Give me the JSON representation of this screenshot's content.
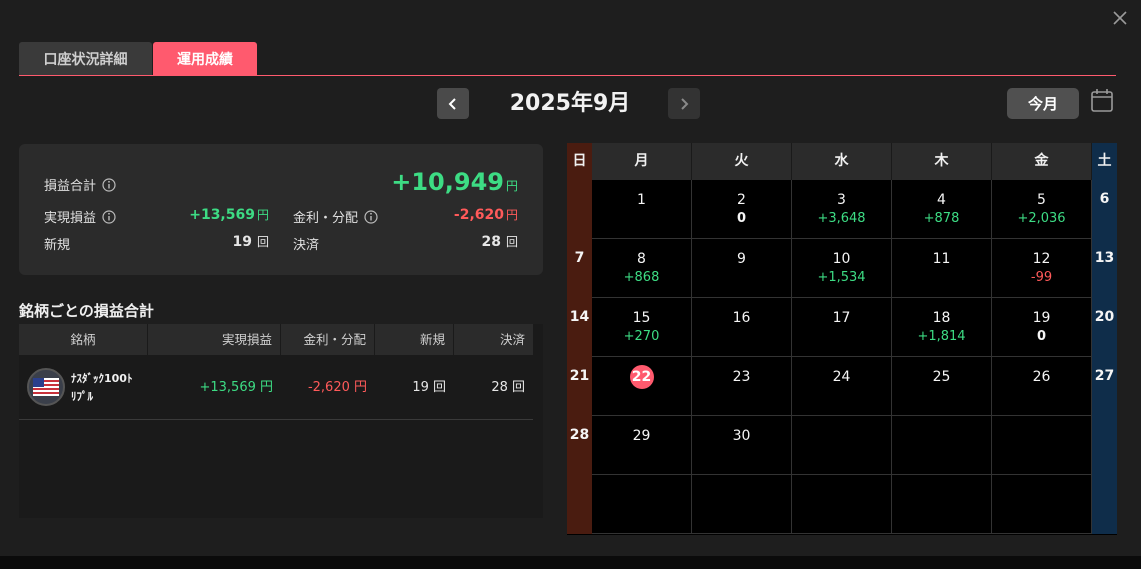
{
  "tabs": [
    {
      "label": "口座状況詳細",
      "active": false
    },
    {
      "label": "運用成績",
      "active": true
    }
  ],
  "nav": {
    "month_title": "2025年9月",
    "today_label": "今月"
  },
  "summary": {
    "total_label": "損益合計",
    "total_value": "+10,949",
    "realized_label": "実現損益",
    "realized_value": "+13,569",
    "interest_label": "金利・分配",
    "interest_value": "-2,620",
    "new_label": "新規",
    "new_value": "19",
    "settle_label": "決済",
    "settle_value": "28",
    "yen": "円",
    "count_unit": "回"
  },
  "symbols": {
    "title": "銘柄ごとの損益合計",
    "headers": [
      "銘柄",
      "実現損益",
      "金利・分配",
      "新規",
      "決済"
    ],
    "rows": [
      {
        "name_line1": "ﾅｽﾀﾞｯｸ100ﾄ",
        "name_line2": "ﾘﾌﾟﾙ",
        "realized": "+13,569 円",
        "interest": "-2,620 円",
        "new": "19 回",
        "settle": "28 回"
      }
    ]
  },
  "calendar": {
    "weekdays": [
      "日",
      "月",
      "火",
      "水",
      "木",
      "金",
      "土"
    ],
    "weeks": [
      [
        {
          "d": ""
        },
        {
          "d": "1",
          "v": ""
        },
        {
          "d": "2",
          "v": "0"
        },
        {
          "d": "3",
          "v": "+3,648"
        },
        {
          "d": "4",
          "v": "+878"
        },
        {
          "d": "5",
          "v": "+2,036"
        },
        {
          "d": "6"
        }
      ],
      [
        {
          "d": "7"
        },
        {
          "d": "8",
          "v": "+868"
        },
        {
          "d": "9",
          "v": ""
        },
        {
          "d": "10",
          "v": "+1,534"
        },
        {
          "d": "11",
          "v": ""
        },
        {
          "d": "12",
          "v": "-99"
        },
        {
          "d": "13"
        }
      ],
      [
        {
          "d": "14"
        },
        {
          "d": "15",
          "v": "+270"
        },
        {
          "d": "16",
          "v": ""
        },
        {
          "d": "17",
          "v": ""
        },
        {
          "d": "18",
          "v": "+1,814"
        },
        {
          "d": "19",
          "v": "0"
        },
        {
          "d": "20"
        }
      ],
      [
        {
          "d": "21"
        },
        {
          "d": "22",
          "v": "",
          "today": true
        },
        {
          "d": "23",
          "v": ""
        },
        {
          "d": "24",
          "v": ""
        },
        {
          "d": "25",
          "v": ""
        },
        {
          "d": "26",
          "v": ""
        },
        {
          "d": "27"
        }
      ],
      [
        {
          "d": "28"
        },
        {
          "d": "29",
          "v": ""
        },
        {
          "d": "30",
          "v": ""
        },
        {
          "d": "",
          "v": ""
        },
        {
          "d": "",
          "v": ""
        },
        {
          "d": "",
          "v": ""
        },
        {
          "d": ""
        }
      ],
      [
        {
          "d": ""
        },
        {
          "d": "",
          "v": ""
        },
        {
          "d": "",
          "v": ""
        },
        {
          "d": "",
          "v": ""
        },
        {
          "d": "",
          "v": ""
        },
        {
          "d": "",
          "v": ""
        },
        {
          "d": ""
        }
      ]
    ]
  },
  "colors": {
    "accent": "#ff5a6e",
    "positive": "#3ddc84",
    "negative": "#ff5a5a",
    "sunday": "#4a1c10",
    "saturday": "#0f2d4a"
  }
}
